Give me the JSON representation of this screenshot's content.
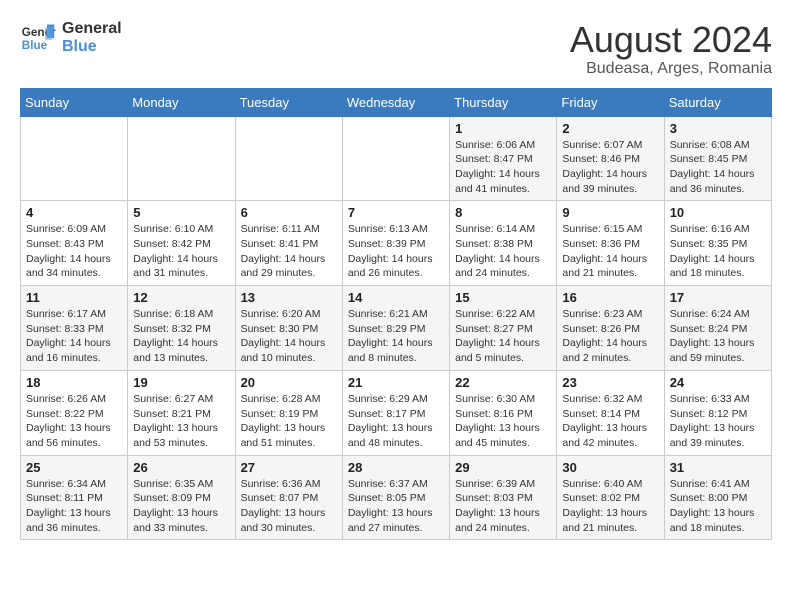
{
  "logo": {
    "line1": "General",
    "line2": "Blue"
  },
  "title": "August 2024",
  "subtitle": "Budeasa, Arges, Romania",
  "days_of_week": [
    "Sunday",
    "Monday",
    "Tuesday",
    "Wednesday",
    "Thursday",
    "Friday",
    "Saturday"
  ],
  "weeks": [
    [
      {
        "day": "",
        "info": ""
      },
      {
        "day": "",
        "info": ""
      },
      {
        "day": "",
        "info": ""
      },
      {
        "day": "",
        "info": ""
      },
      {
        "day": "1",
        "info": "Sunrise: 6:06 AM\nSunset: 8:47 PM\nDaylight: 14 hours and 41 minutes."
      },
      {
        "day": "2",
        "info": "Sunrise: 6:07 AM\nSunset: 8:46 PM\nDaylight: 14 hours and 39 minutes."
      },
      {
        "day": "3",
        "info": "Sunrise: 6:08 AM\nSunset: 8:45 PM\nDaylight: 14 hours and 36 minutes."
      }
    ],
    [
      {
        "day": "4",
        "info": "Sunrise: 6:09 AM\nSunset: 8:43 PM\nDaylight: 14 hours and 34 minutes."
      },
      {
        "day": "5",
        "info": "Sunrise: 6:10 AM\nSunset: 8:42 PM\nDaylight: 14 hours and 31 minutes."
      },
      {
        "day": "6",
        "info": "Sunrise: 6:11 AM\nSunset: 8:41 PM\nDaylight: 14 hours and 29 minutes."
      },
      {
        "day": "7",
        "info": "Sunrise: 6:13 AM\nSunset: 8:39 PM\nDaylight: 14 hours and 26 minutes."
      },
      {
        "day": "8",
        "info": "Sunrise: 6:14 AM\nSunset: 8:38 PM\nDaylight: 14 hours and 24 minutes."
      },
      {
        "day": "9",
        "info": "Sunrise: 6:15 AM\nSunset: 8:36 PM\nDaylight: 14 hours and 21 minutes."
      },
      {
        "day": "10",
        "info": "Sunrise: 6:16 AM\nSunset: 8:35 PM\nDaylight: 14 hours and 18 minutes."
      }
    ],
    [
      {
        "day": "11",
        "info": "Sunrise: 6:17 AM\nSunset: 8:33 PM\nDaylight: 14 hours and 16 minutes."
      },
      {
        "day": "12",
        "info": "Sunrise: 6:18 AM\nSunset: 8:32 PM\nDaylight: 14 hours and 13 minutes."
      },
      {
        "day": "13",
        "info": "Sunrise: 6:20 AM\nSunset: 8:30 PM\nDaylight: 14 hours and 10 minutes."
      },
      {
        "day": "14",
        "info": "Sunrise: 6:21 AM\nSunset: 8:29 PM\nDaylight: 14 hours and 8 minutes."
      },
      {
        "day": "15",
        "info": "Sunrise: 6:22 AM\nSunset: 8:27 PM\nDaylight: 14 hours and 5 minutes."
      },
      {
        "day": "16",
        "info": "Sunrise: 6:23 AM\nSunset: 8:26 PM\nDaylight: 14 hours and 2 minutes."
      },
      {
        "day": "17",
        "info": "Sunrise: 6:24 AM\nSunset: 8:24 PM\nDaylight: 13 hours and 59 minutes."
      }
    ],
    [
      {
        "day": "18",
        "info": "Sunrise: 6:26 AM\nSunset: 8:22 PM\nDaylight: 13 hours and 56 minutes."
      },
      {
        "day": "19",
        "info": "Sunrise: 6:27 AM\nSunset: 8:21 PM\nDaylight: 13 hours and 53 minutes."
      },
      {
        "day": "20",
        "info": "Sunrise: 6:28 AM\nSunset: 8:19 PM\nDaylight: 13 hours and 51 minutes."
      },
      {
        "day": "21",
        "info": "Sunrise: 6:29 AM\nSunset: 8:17 PM\nDaylight: 13 hours and 48 minutes."
      },
      {
        "day": "22",
        "info": "Sunrise: 6:30 AM\nSunset: 8:16 PM\nDaylight: 13 hours and 45 minutes."
      },
      {
        "day": "23",
        "info": "Sunrise: 6:32 AM\nSunset: 8:14 PM\nDaylight: 13 hours and 42 minutes."
      },
      {
        "day": "24",
        "info": "Sunrise: 6:33 AM\nSunset: 8:12 PM\nDaylight: 13 hours and 39 minutes."
      }
    ],
    [
      {
        "day": "25",
        "info": "Sunrise: 6:34 AM\nSunset: 8:11 PM\nDaylight: 13 hours and 36 minutes."
      },
      {
        "day": "26",
        "info": "Sunrise: 6:35 AM\nSunset: 8:09 PM\nDaylight: 13 hours and 33 minutes."
      },
      {
        "day": "27",
        "info": "Sunrise: 6:36 AM\nSunset: 8:07 PM\nDaylight: 13 hours and 30 minutes."
      },
      {
        "day": "28",
        "info": "Sunrise: 6:37 AM\nSunset: 8:05 PM\nDaylight: 13 hours and 27 minutes."
      },
      {
        "day": "29",
        "info": "Sunrise: 6:39 AM\nSunset: 8:03 PM\nDaylight: 13 hours and 24 minutes."
      },
      {
        "day": "30",
        "info": "Sunrise: 6:40 AM\nSunset: 8:02 PM\nDaylight: 13 hours and 21 minutes."
      },
      {
        "day": "31",
        "info": "Sunrise: 6:41 AM\nSunset: 8:00 PM\nDaylight: 13 hours and 18 minutes."
      }
    ]
  ]
}
